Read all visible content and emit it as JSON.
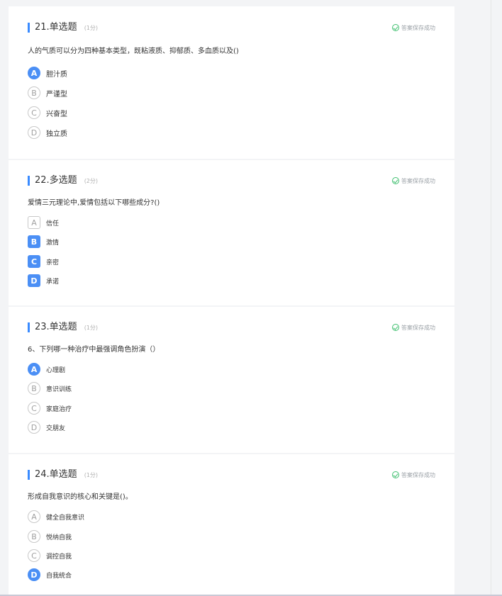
{
  "questions": [
    {
      "title": "21.单选题",
      "score": "(1分)",
      "status": "答案保存成功",
      "text": "人的气质可以分为四种基本类型，既粘液质、抑郁质、多血质以及()",
      "options": [
        {
          "letter": "A",
          "label": "胆汁质",
          "selected": true
        },
        {
          "letter": "B",
          "label": "严谨型",
          "selected": false
        },
        {
          "letter": "C",
          "label": "兴奋型",
          "selected": false
        },
        {
          "letter": "D",
          "label": "独立质",
          "selected": false
        }
      ]
    },
    {
      "title": "22.多选题",
      "score": "(2分)",
      "status": "答案保存成功",
      "text": "爱情三元理论中,爱情包括以下哪些成分?()",
      "options": [
        {
          "letter": "A",
          "label": "信任",
          "selected": false
        },
        {
          "letter": "B",
          "label": "激情",
          "selected": true
        },
        {
          "letter": "C",
          "label": "亲密",
          "selected": true
        },
        {
          "letter": "D",
          "label": "承诺",
          "selected": true
        }
      ]
    },
    {
      "title": "23.单选题",
      "score": "(1分)",
      "status": "答案保存成功",
      "text": "6、下列哪一种治疗中最强调角色扮演（）",
      "options": [
        {
          "letter": "A",
          "label": "心理剧",
          "selected": true
        },
        {
          "letter": "B",
          "label": "意识训练",
          "selected": false
        },
        {
          "letter": "C",
          "label": "家庭治疗",
          "selected": false
        },
        {
          "letter": "D",
          "label": "交朋友",
          "selected": false
        }
      ]
    },
    {
      "title": "24.单选题",
      "score": "(1分)",
      "status": "答案保存成功",
      "text": "形成自我意识的核心和关键是()。",
      "options": [
        {
          "letter": "A",
          "label": "健全自我意识",
          "selected": false
        },
        {
          "letter": "B",
          "label": "悦纳自我",
          "selected": false
        },
        {
          "letter": "C",
          "label": "调控自我",
          "selected": false
        },
        {
          "letter": "D",
          "label": "自我统合",
          "selected": true
        }
      ]
    }
  ],
  "colors": {
    "accent": "#4b8ff5",
    "saved": "#3fbf6f"
  }
}
